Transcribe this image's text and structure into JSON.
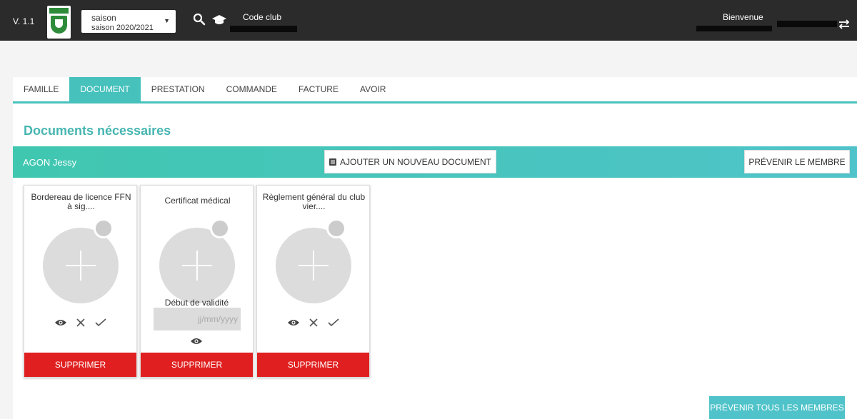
{
  "header": {
    "version": "V. 1.1",
    "season_label": "saison",
    "season_value": "saison 2020/2021",
    "code_club_label": "Code club",
    "welcome_label": "Bienvenue"
  },
  "tabs": [
    {
      "label": "FAMILLE"
    },
    {
      "label": "DOCUMENT"
    },
    {
      "label": "PRESTATION"
    },
    {
      "label": "COMMANDE"
    },
    {
      "label": "FACTURE"
    },
    {
      "label": "AVOIR"
    }
  ],
  "active_tab": "DOCUMENT",
  "page": {
    "title": "Documents nécessaires",
    "member_name": "AGON Jessy",
    "add_document_label": "AJOUTER UN NOUVEAU DOCUMENT",
    "notify_member_label": "PRÉVENIR LE MEMBRE",
    "notify_all_label": "PRÉVENIR TOUS LES MEMBRES"
  },
  "cards": [
    {
      "title": "Bordereau de licence FFN à sig....",
      "delete_label": "SUPPRIMER"
    },
    {
      "title": "Certificat médical",
      "validity_label": "Début de validité",
      "date_placeholder": "jj/mm/yyyy",
      "delete_label": "SUPPRIMER"
    },
    {
      "title": "Règlement général du club vier....",
      "delete_label": "SUPPRIMER"
    }
  ],
  "colors": {
    "accent": "#47c1bc",
    "danger": "#e02020",
    "topbar": "#2b2b2b"
  }
}
